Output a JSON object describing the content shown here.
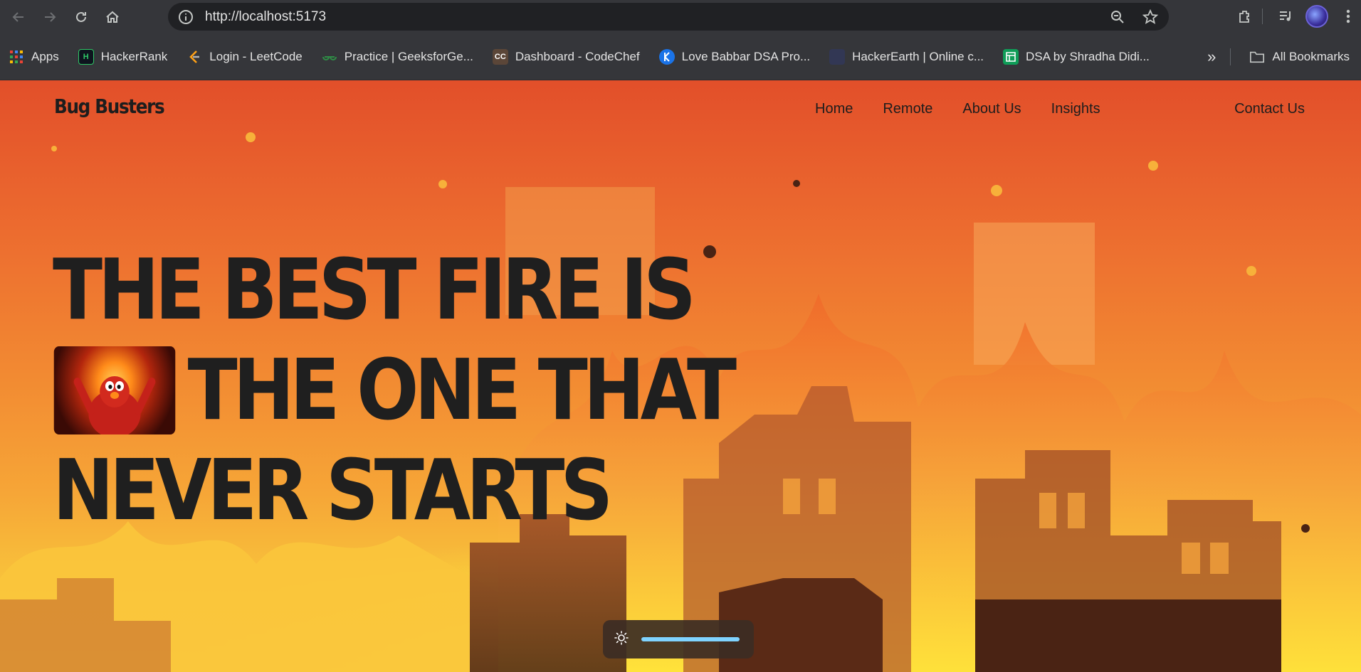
{
  "browser": {
    "url": "http://localhost:5173",
    "bookmarks": [
      {
        "label": "Apps",
        "icon": "apps-grid-icon",
        "color": "#ea4335"
      },
      {
        "label": "HackerRank",
        "icon": "hackerrank-icon",
        "color": "#0e141e"
      },
      {
        "label": "Login - LeetCode",
        "icon": "leetcode-icon",
        "color": "#ffa116"
      },
      {
        "label": "Practice | GeeksforGe...",
        "icon": "geeksforgeeks-icon",
        "color": "#2f8d46"
      },
      {
        "label": "Dashboard - CodeChef",
        "icon": "codechef-icon",
        "color": "#5b4638"
      },
      {
        "label": "Love Babbar DSA Pro...",
        "icon": "love-babbar-icon",
        "color": "#1a73e8"
      },
      {
        "label": "HackerEarth | Online c...",
        "icon": "hackerearth-icon",
        "color": "#323754"
      },
      {
        "label": "DSA by Shradha Didi...",
        "icon": "google-sheets-icon",
        "color": "#0f9d58"
      }
    ],
    "all_bookmarks_label": "All Bookmarks"
  },
  "site": {
    "logo": "Bug Busters",
    "nav": [
      "Home",
      "Remote",
      "About Us",
      "Insights"
    ],
    "contact": "Contact Us",
    "hero": {
      "line1": "THE BEST FIRE IS",
      "line2": "THE ONE THAT",
      "line3": "NEVER STARTS"
    },
    "theme_toggle": {
      "icon": "sun-icon",
      "track_color": "#7fd3ff"
    }
  },
  "colors": {
    "text_dark": "#1d1d1d",
    "sky_top": "#e24f2a",
    "fire_yellow": "#f8d23c"
  }
}
